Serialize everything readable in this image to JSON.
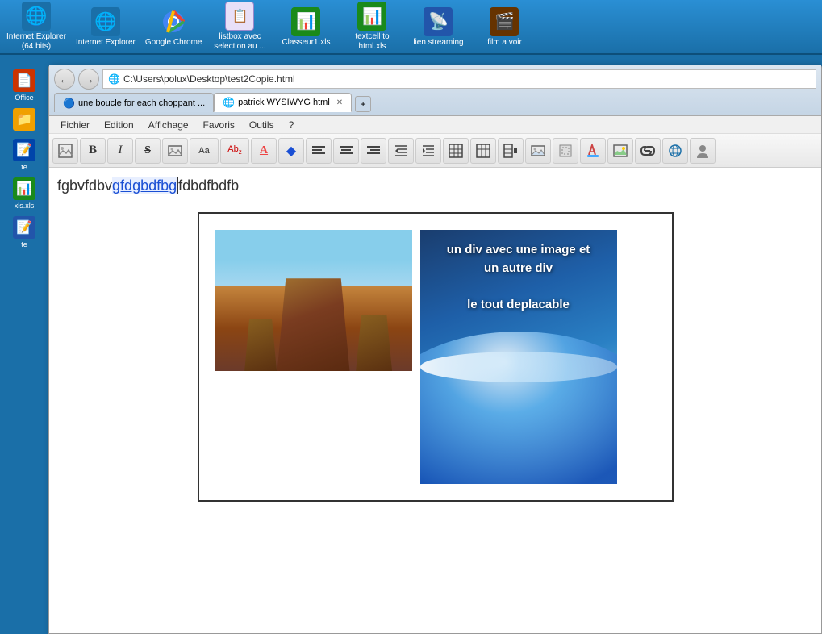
{
  "taskbar": {
    "items": [
      {
        "label": "Internet Explorer\n(64 bits)",
        "icon": "🌐"
      },
      {
        "label": "Internet Explorer",
        "icon": "🌐"
      },
      {
        "label": "Google Chrome",
        "icon": "🔵"
      },
      {
        "label": "listbox avec\nselection au ...",
        "icon": "📋"
      },
      {
        "label": "Classeur1.xls",
        "icon": "📊"
      },
      {
        "label": "textcell to\nhtml.xls",
        "icon": "📊"
      },
      {
        "label": "lien streaming",
        "icon": "📡"
      },
      {
        "label": "film a voir",
        "icon": "🎬"
      }
    ]
  },
  "browser": {
    "address": "C:\\Users\\polux\\Desktop\\test2Copie.html",
    "tabs": [
      {
        "label": "une boucle for each choppant ...",
        "active": false,
        "icon": "🔵"
      },
      {
        "label": "patrick WYSIWYG html",
        "active": true,
        "icon": "🌐"
      }
    ],
    "menu": {
      "items": [
        "Fichier",
        "Edition",
        "Affichage",
        "Favoris",
        "Outils",
        "?"
      ]
    }
  },
  "editor": {
    "text_normal": "fgbvfdbv",
    "text_highlighted": "gfdgbdfbg",
    "text_after": "fdbdfbdfb"
  },
  "content_box": {
    "wave_text_line1": "un div  avec une image et",
    "wave_text_line2": "un autre div",
    "wave_text_line3": "le  tout deplacable"
  },
  "desktop_left": {
    "items": [
      {
        "label": "Office",
        "icon": "📄"
      },
      {
        "label": "",
        "icon": "📁"
      },
      {
        "label": "te",
        "icon": "📝"
      },
      {
        "label": "xls.xls",
        "icon": "📊"
      },
      {
        "label": "te",
        "icon": "📝"
      }
    ]
  },
  "toolbar": {
    "buttons": [
      {
        "name": "image-icon",
        "symbol": "🖼"
      },
      {
        "name": "bold-icon",
        "symbol": "B"
      },
      {
        "name": "italic-icon",
        "symbol": "I"
      },
      {
        "name": "strikethrough-icon",
        "symbol": "S"
      },
      {
        "name": "image2-icon",
        "symbol": "🖼"
      },
      {
        "name": "font-icon",
        "symbol": "A"
      },
      {
        "name": "fontsize-icon",
        "symbol": "Az"
      },
      {
        "name": "color-icon",
        "symbol": "A"
      },
      {
        "name": "special-icon",
        "symbol": "◆"
      },
      {
        "name": "align-left-icon",
        "symbol": "≡"
      },
      {
        "name": "align-center-icon",
        "symbol": "≡"
      },
      {
        "name": "align-right-icon",
        "symbol": "≡"
      },
      {
        "name": "indent-icon",
        "symbol": "→"
      },
      {
        "name": "outdent-icon",
        "symbol": "←"
      },
      {
        "name": "table-icon",
        "symbol": "⊞"
      },
      {
        "name": "table2-icon",
        "symbol": "⊟"
      },
      {
        "name": "table3-icon",
        "symbol": "⊞"
      },
      {
        "name": "img-insert-icon",
        "symbol": "🖼"
      },
      {
        "name": "img2-icon",
        "symbol": "🖼"
      },
      {
        "name": "paint-icon",
        "symbol": "🖌"
      },
      {
        "name": "img3-icon",
        "symbol": "🖼"
      },
      {
        "name": "link-icon",
        "symbol": "🔗"
      },
      {
        "name": "globe-icon",
        "symbol": "🌐"
      },
      {
        "name": "person-icon",
        "symbol": "👤"
      }
    ]
  }
}
